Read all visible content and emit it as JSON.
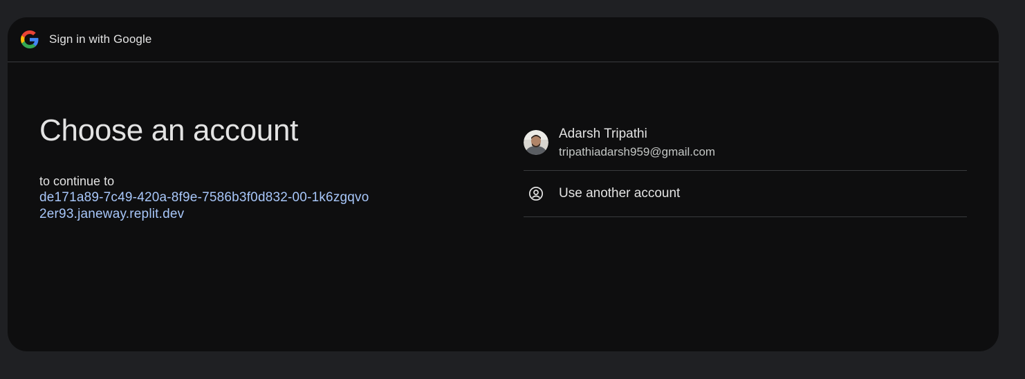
{
  "header": {
    "title": "Sign in with Google",
    "logo_icon": "google-g-icon"
  },
  "main": {
    "heading": "Choose an account",
    "subtitle": "to continue to",
    "target_url": "de171a89-7c49-420a-8f9e-7586b3f0d832-00-1k6zgqvo2er93.janeway.replit.dev"
  },
  "accounts": [
    {
      "name": "Adarsh Tripathi",
      "email": "tripathiadarsh959@gmail.com",
      "avatar_icon": "user-photo-avatar"
    }
  ],
  "another_account": {
    "label": "Use another account",
    "icon": "account-circle-icon"
  },
  "colors": {
    "page_bg": "#1f2023",
    "card_bg": "#0e0e0f",
    "text_primary": "#e3e3e3",
    "text_secondary": "#c4c7c5",
    "link": "#a8c7fa",
    "divider": "#3a3b3e"
  }
}
